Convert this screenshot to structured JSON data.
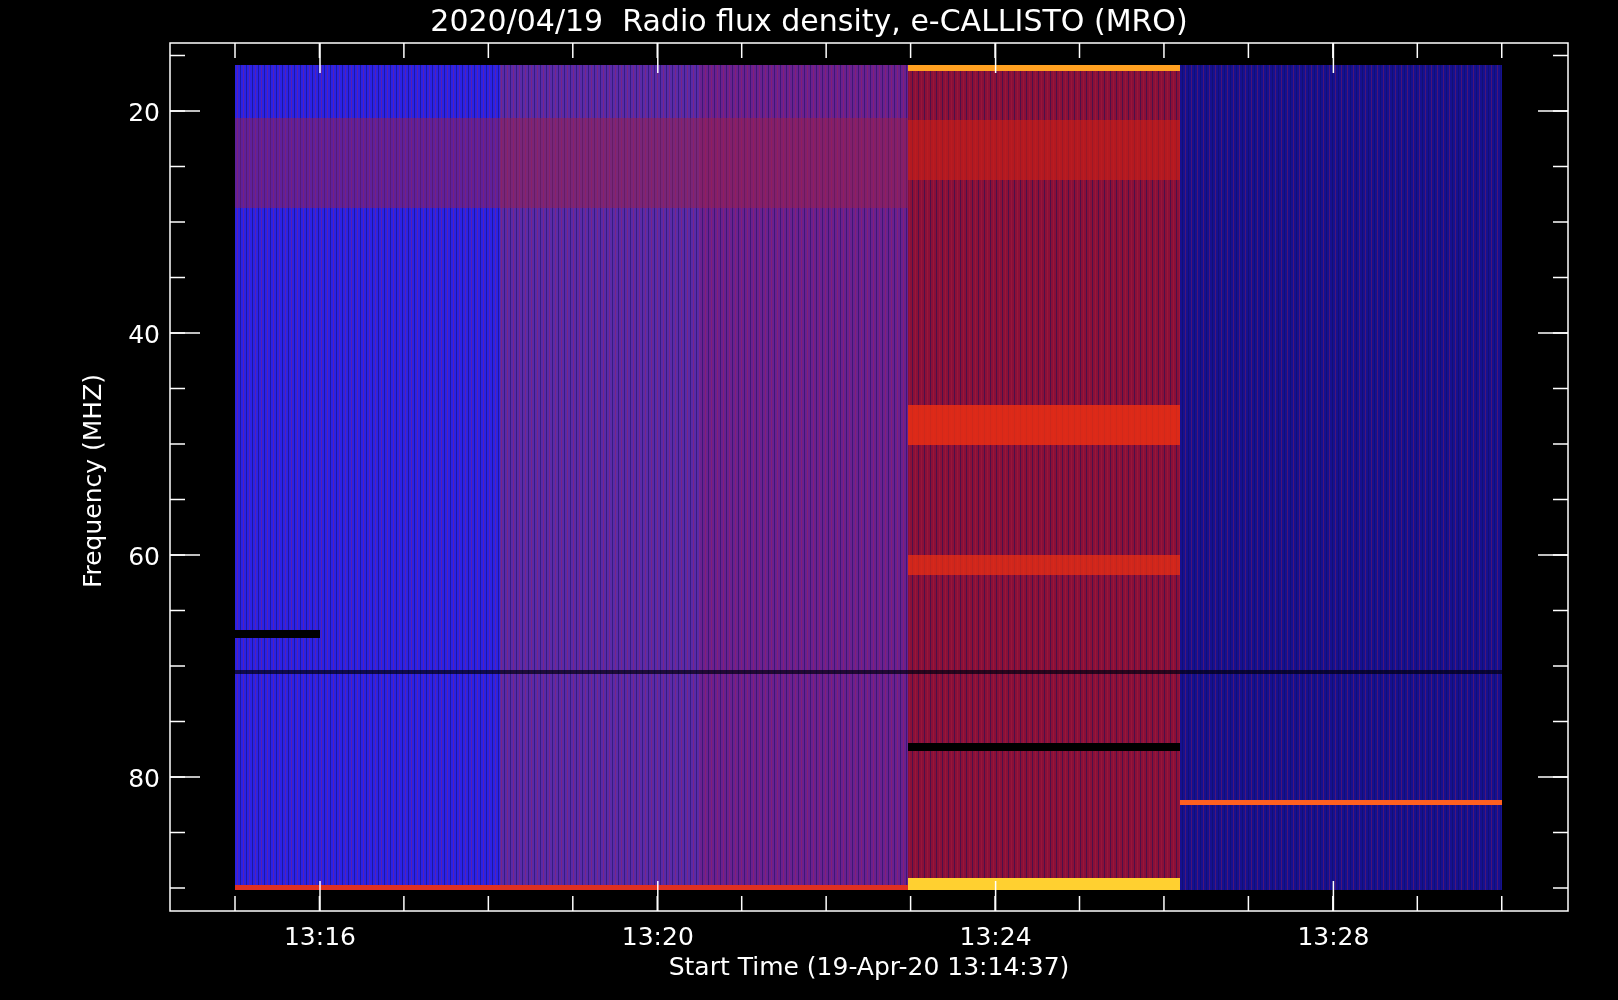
{
  "title": "2020/04/19  Radio flux density, e-CALLISTO (MRO)",
  "y_axis": {
    "label": "Frequency (MHZ)",
    "ticks": [
      "20",
      "40",
      "60",
      "80"
    ]
  },
  "x_axis": {
    "label": "Start Time (19-Apr-20 13:14:37)",
    "ticks": [
      "13:16",
      "13:20",
      "13:24",
      "13:28"
    ]
  }
}
